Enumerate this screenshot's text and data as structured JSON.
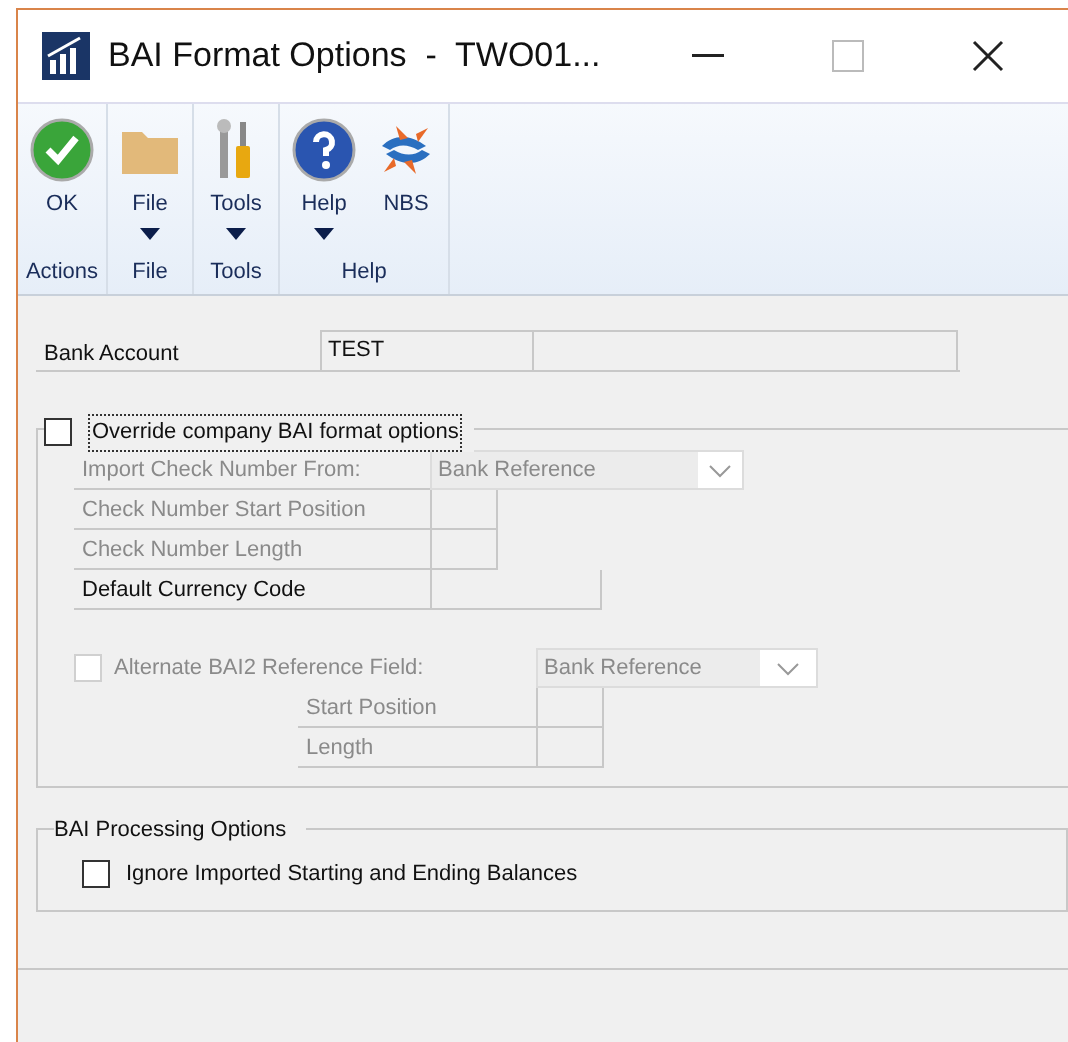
{
  "window": {
    "title": "BAI Format Options  -  TWO01..."
  },
  "ribbon": {
    "groups": [
      {
        "label": "Actions",
        "buttons": [
          {
            "label": "OK",
            "kind": "check",
            "dropdown": false
          }
        ]
      },
      {
        "label": "File",
        "buttons": [
          {
            "label": "File",
            "kind": "folder",
            "dropdown": true
          }
        ]
      },
      {
        "label": "Tools",
        "buttons": [
          {
            "label": "Tools",
            "kind": "tools",
            "dropdown": true
          }
        ]
      },
      {
        "label": "Help",
        "buttons": [
          {
            "label": "Help",
            "kind": "question",
            "dropdown": true
          },
          {
            "label": "NBS",
            "kind": "swirl",
            "dropdown": false
          }
        ]
      }
    ]
  },
  "bank_account": {
    "label": "Bank Account",
    "value": "TEST"
  },
  "override": {
    "label": "Override company BAI format options",
    "checked": false,
    "disabled": false,
    "rows": [
      {
        "kind": "dropdown",
        "label": "Import Check Number From:",
        "value": "Bank Reference",
        "disabled": true
      },
      {
        "kind": "input",
        "label": "Check Number Start Position",
        "disabled": true
      },
      {
        "kind": "input",
        "label": "Check Number Length",
        "disabled": true
      },
      {
        "kind": "wide-input",
        "label": "Default Currency Code",
        "disabled": false
      }
    ],
    "alternate": {
      "label": "Alternate BAI2 Reference Field:",
      "checked": false,
      "disabled": true,
      "value": "Bank Reference",
      "rows": [
        {
          "kind": "input",
          "label": "Start Position",
          "disabled": true
        },
        {
          "kind": "input",
          "label": "Length",
          "disabled": true
        }
      ]
    }
  },
  "processing": {
    "title": "BAI Processing Options",
    "options": [
      {
        "label": "Ignore Imported Starting and Ending Balances",
        "checked": false,
        "disabled": false
      }
    ]
  }
}
